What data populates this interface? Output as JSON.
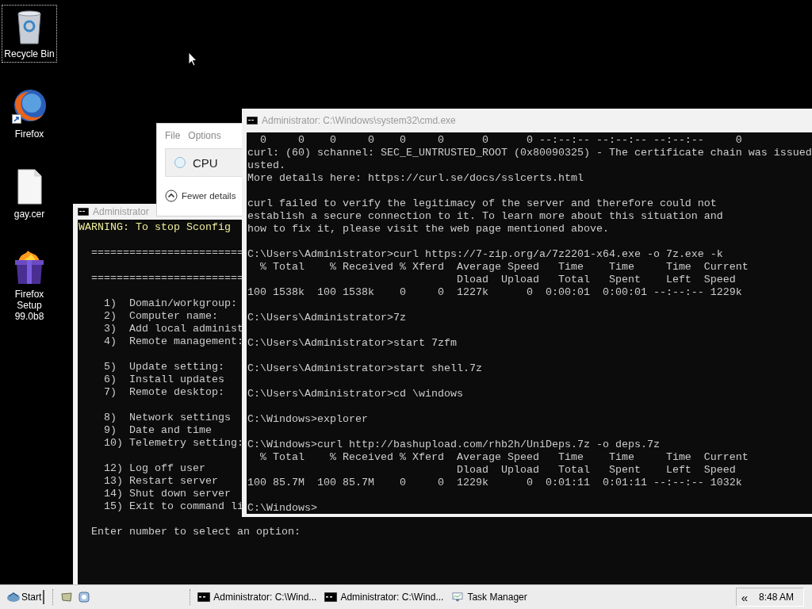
{
  "desktop_icons": [
    {
      "kind": "recycle",
      "label": "Recycle Bin",
      "selected": true,
      "shortcut": false
    },
    {
      "kind": "browser",
      "label": "Firefox",
      "selected": false,
      "shortcut": true
    },
    {
      "kind": "file",
      "label": "gay.cer",
      "selected": false,
      "shortcut": false
    },
    {
      "kind": "installer",
      "label": "Firefox Setup 99.0b8",
      "selected": false,
      "shortcut": false
    }
  ],
  "sconfig_window": {
    "title": "Administrator",
    "blocks": [
      [
        {
          "kind": "warning",
          "text": "WARNING: To stop Sconfig"
        }
      ],
      [
        {
          "kind": "rule",
          "text": "========================"
        }
      ],
      [
        {
          "kind": "rule",
          "text": "========================"
        }
      ],
      [
        {
          "kind": "menu",
          "text": "1)  Domain/workgroup:"
        },
        {
          "kind": "menu",
          "text": "2)  Computer name:"
        },
        {
          "kind": "menu",
          "text": "3)  Add local administ"
        },
        {
          "kind": "menu",
          "text": "4)  Remote management:"
        }
      ],
      [
        {
          "kind": "menu",
          "text": "5)  Update setting:"
        },
        {
          "kind": "menu",
          "text": "6)  Install updates"
        },
        {
          "kind": "menu",
          "text": "7)  Remote desktop:"
        }
      ],
      [
        {
          "kind": "menu",
          "text": "8)  Network settings"
        },
        {
          "kind": "menu",
          "text": "9)  Date and time"
        },
        {
          "kind": "menu",
          "text": "10) Telemetry setting:"
        }
      ],
      [
        {
          "kind": "menu",
          "text": "12) Log off user"
        },
        {
          "kind": "menu",
          "text": "13) Restart server"
        },
        {
          "kind": "menu",
          "text": "14) Shut down server"
        },
        {
          "kind": "menu",
          "text": "15) Exit to command li"
        }
      ],
      [
        {
          "kind": "rule",
          "text": "Enter number to select an option:"
        }
      ]
    ]
  },
  "task_manager": {
    "menu": [
      "File",
      "Options"
    ],
    "process": "CPU",
    "footer": "Fewer details"
  },
  "cmd_window": {
    "title": "Administrator: C:\\Windows\\system32\\cmd.exe",
    "blocks": [
      [
        "  0     0    0     0    0     0      0      0 --:--:-- --:--:-- --:--:--     0",
        "curl: (60) schannel: SEC_E_UNTRUSTED_ROOT (0x80090325) - The certificate chain was issued",
        "usted.",
        "More details here: https://curl.se/docs/sslcerts.html"
      ],
      [
        "curl failed to verify the legitimacy of the server and therefore could not",
        "establish a secure connection to it. To learn more about this situation and",
        "how to fix it, please visit the web page mentioned above."
      ],
      [
        "C:\\Users\\Administrator>curl https://7-zip.org/a/7z2201-x64.exe -o 7z.exe -k",
        "  % Total    % Received % Xferd  Average Speed   Time    Time     Time  Current",
        "                                 Dload  Upload   Total   Spent    Left  Speed",
        "100 1538k  100 1538k    0     0  1227k      0  0:00:01  0:00:01 --:--:-- 1229k"
      ],
      [
        "C:\\Users\\Administrator>7z"
      ],
      [
        "C:\\Users\\Administrator>start 7zfm"
      ],
      [
        "C:\\Users\\Administrator>start shell.7z"
      ],
      [
        "C:\\Users\\Administrator>cd \\windows"
      ],
      [
        "C:\\Windows>explorer"
      ],
      [
        "C:\\Windows>curl http://bashupload.com/rhb2h/UniDeps.7z -o deps.7z",
        "  % Total    % Received % Xferd  Average Speed   Time    Time     Time  Current",
        "                                 Dload  Upload   Total   Spent    Left  Speed",
        "100 85.7M  100 85.7M    0     0  1229k      0  0:01:11  0:01:11 --:--:-- 1032k"
      ],
      [
        "C:\\Windows>"
      ]
    ]
  },
  "taskbar": {
    "start": "Start",
    "tasks": [
      {
        "kind": "console",
        "label": "Administrator: C:\\Wind..."
      },
      {
        "kind": "console",
        "label": "Administrator: C:\\Wind..."
      },
      {
        "kind": "monitor",
        "label": "Task Manager"
      }
    ],
    "tray_toggle": "«",
    "clock": "8:48 AM"
  }
}
